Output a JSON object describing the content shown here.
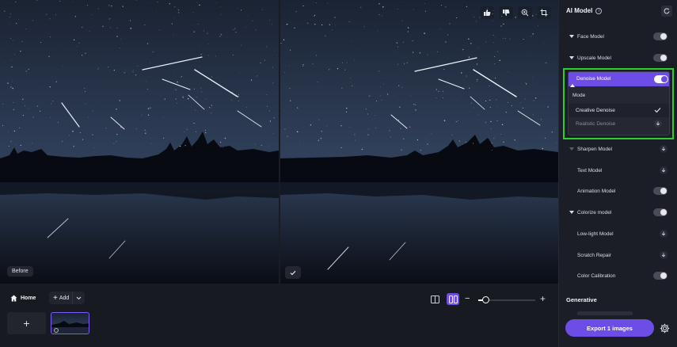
{
  "preview": {
    "before_label": "Before"
  },
  "toolbar": {
    "home_label": "Home",
    "add_label": "Add"
  },
  "panel": {
    "title": "AI Model",
    "models": [
      {
        "label": "Face Model",
        "control": "toggle",
        "on": false
      },
      {
        "label": "Upscale Model",
        "control": "toggle",
        "on": false
      },
      {
        "label": "Denoise Model",
        "control": "toggle",
        "on": true
      },
      {
        "label": "Sharpen Model",
        "control": "download"
      },
      {
        "label": "Text Model",
        "control": "download"
      },
      {
        "label": "Animation Model",
        "control": "toggle",
        "on": false
      },
      {
        "label": "Colorize model",
        "control": "toggle",
        "on": false
      },
      {
        "label": "Low-light Model",
        "control": "download"
      },
      {
        "label": "Scratch Repair",
        "control": "download"
      },
      {
        "label": "Color Calibration",
        "control": "toggle",
        "on": false
      }
    ],
    "denoise": {
      "mode_label": "Mode",
      "options": [
        "Creative Denoise",
        "Realistic Denoise"
      ],
      "selected": "Creative Denoise"
    },
    "generative_title": "Generative",
    "export_label": "Export 1 images"
  },
  "colors": {
    "accent": "#6c4ee6",
    "highlight_box": "#2ad12a",
    "panel_bg": "#1c1e27"
  }
}
